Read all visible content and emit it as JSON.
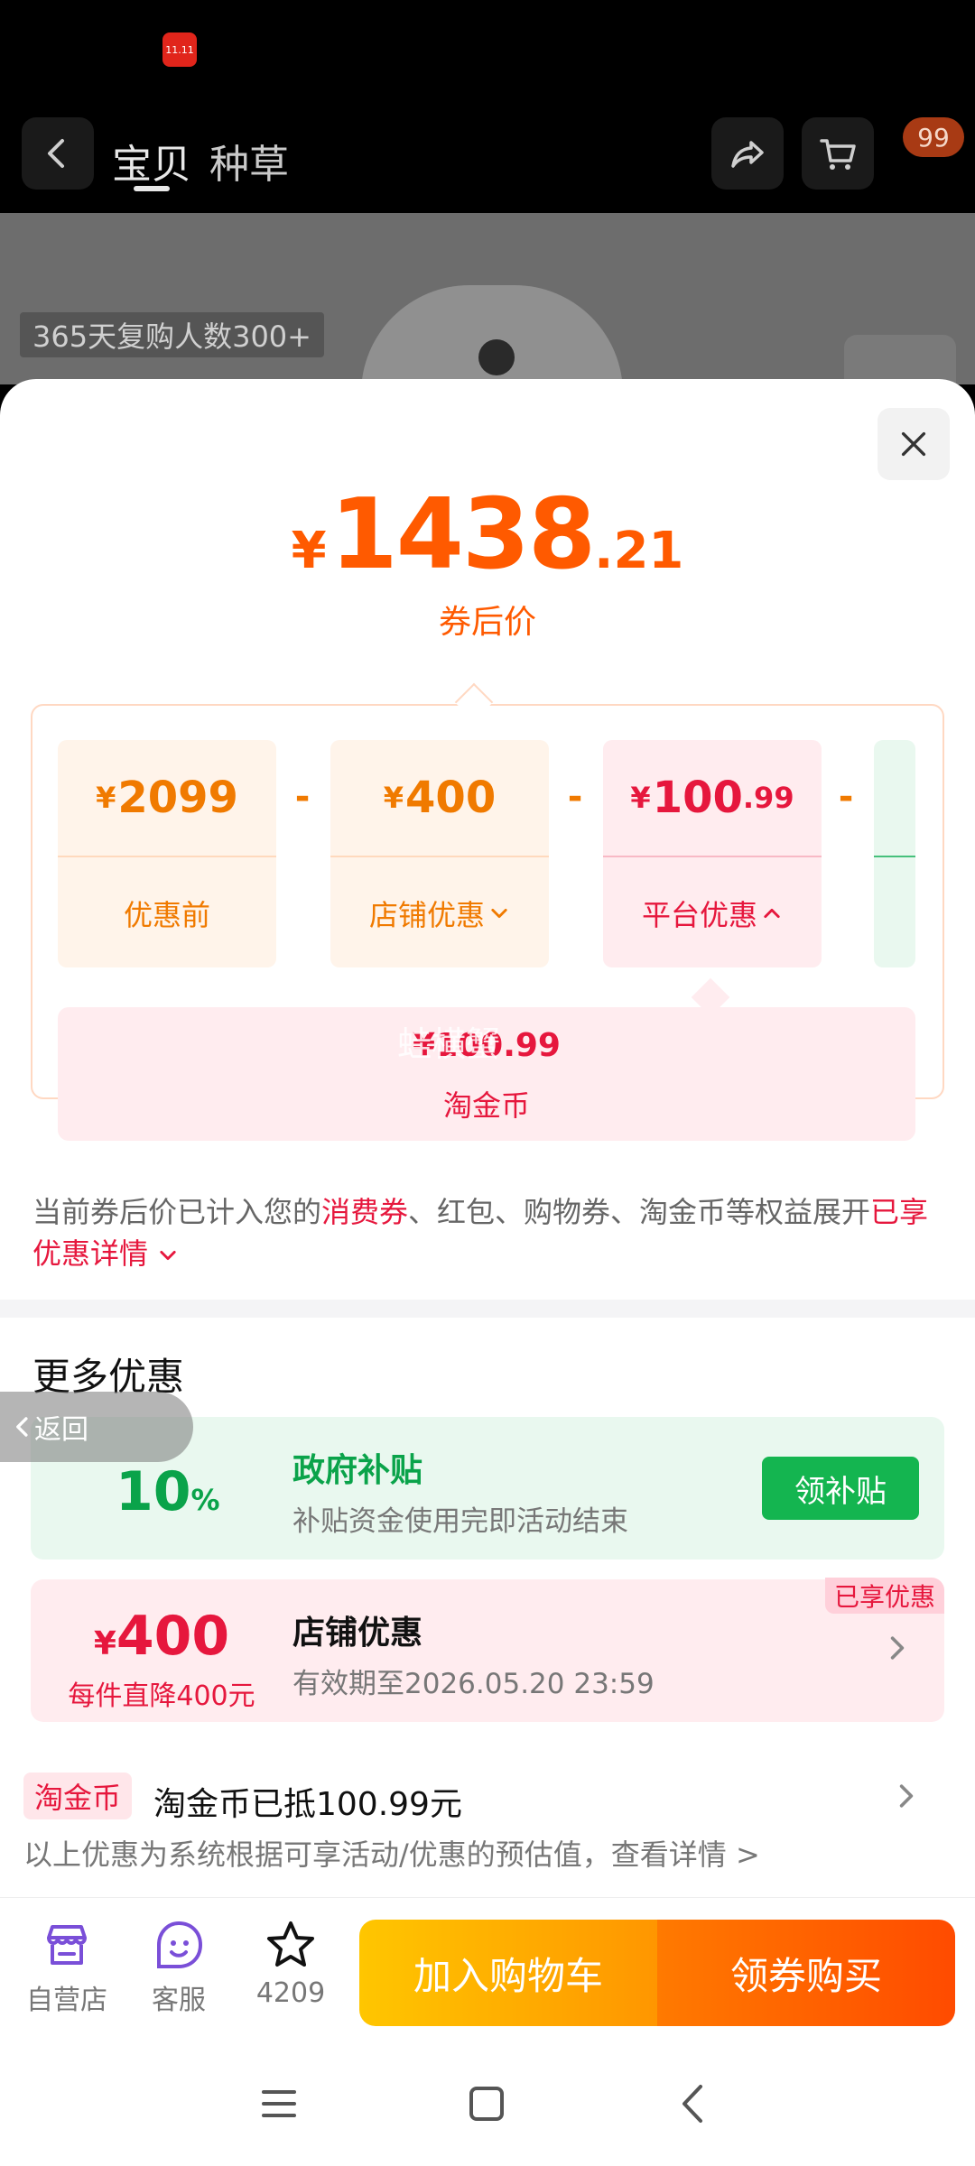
{
  "status_bar": {
    "app_badge": "11.11"
  },
  "nav": {
    "tabs": [
      "宝贝",
      "种草"
    ],
    "cart_count": "99"
  },
  "hero": {
    "repurchase_tag": "365天复购人数300+"
  },
  "price": {
    "symbol": "¥",
    "integer": "1438",
    "decimal": ".21",
    "label": "券后价"
  },
  "breakdown": {
    "items": [
      {
        "symbol": "¥",
        "value": "2099",
        "decimal": "",
        "label": "优惠前"
      },
      {
        "symbol": "¥",
        "value": "400",
        "decimal": "",
        "label": "店铺优惠"
      },
      {
        "symbol": "¥",
        "value": "100",
        "decimal": ".99",
        "label": "平台优惠"
      }
    ],
    "minus": "-",
    "coin": {
      "value": "¥100.99",
      "label": "淘金币"
    },
    "watermark": "蛙横蟹"
  },
  "notice": {
    "part1": "当前券后价已计入您的",
    "highlight1": "消费券",
    "part2": "、红包、购物券、淘金币等权益展开",
    "highlight2": "已享优惠详情"
  },
  "more": {
    "title": "更多优惠",
    "back_label": "返回",
    "gov": {
      "rate": "10",
      "rate_unit": "%",
      "title": "政府补贴",
      "subtitle": "补贴资金使用完即活动结束",
      "button": "领补贴"
    },
    "shop": {
      "symbol": "¥",
      "amount": "400",
      "desc": "每件直降400元",
      "title": "店铺优惠",
      "subtitle": "有效期至2026.05.20 23:59",
      "tag": "已享优惠"
    },
    "coin": {
      "tag": "淘金币",
      "text": "淘金币已抵100.99元"
    },
    "disclaimer": "以上优惠为系统根据可享活动/优惠的预估值，查看详情 >"
  },
  "action_bar": {
    "store": "自营店",
    "service": "客服",
    "favorites": "4209",
    "add_cart": "加入购物车",
    "buy": "领券购买"
  },
  "colors": {
    "accent_orange": "#ff5a00",
    "accent_red": "#e6173d",
    "accent_green": "#0aa34a",
    "icon_purple": "#7a4fd8"
  }
}
